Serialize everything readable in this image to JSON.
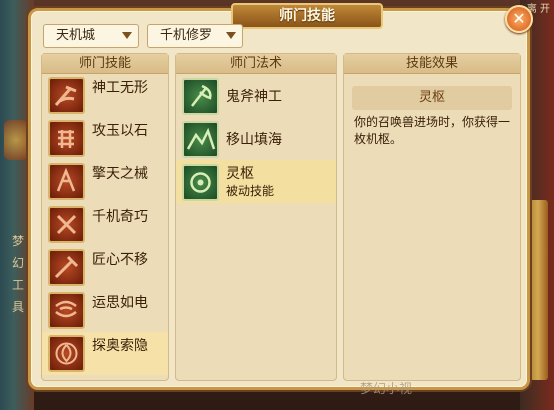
{
  "window": {
    "title": "师门技能",
    "close_icon": "close-icon"
  },
  "filters": {
    "sect": "天机城",
    "master": "千机修罗"
  },
  "skills_column": {
    "header": "师门技能",
    "items": [
      {
        "label": "神工无形",
        "icon": "hammer-icon"
      },
      {
        "label": "攻玉以石",
        "icon": "stone-icon"
      },
      {
        "label": "擎天之械",
        "icon": "mechanism-icon"
      },
      {
        "label": "千机奇巧",
        "icon": "tools-icon"
      },
      {
        "label": "匠心不移",
        "icon": "craft-icon"
      },
      {
        "label": "运思如电",
        "icon": "swirl-icon"
      },
      {
        "label": "探奥索隐",
        "icon": "vortex-icon",
        "selected": true
      }
    ]
  },
  "arts_column": {
    "header": "师门法术",
    "items": [
      {
        "label": "鬼斧神工",
        "icon": "axe-icon"
      },
      {
        "label": "移山填海",
        "icon": "mountain-icon"
      },
      {
        "label": "灵枢",
        "sublabel": "被动技能",
        "icon": "spirit-icon",
        "selected": true
      }
    ]
  },
  "effect_column": {
    "header": "技能效果",
    "name": "灵枢",
    "description": "你的召唤兽进场时，你获得一枚机枢。"
  },
  "background": {
    "left_text": "梦幻工具",
    "top_right_text": "离 开",
    "watermark": "梦幻小视"
  }
}
